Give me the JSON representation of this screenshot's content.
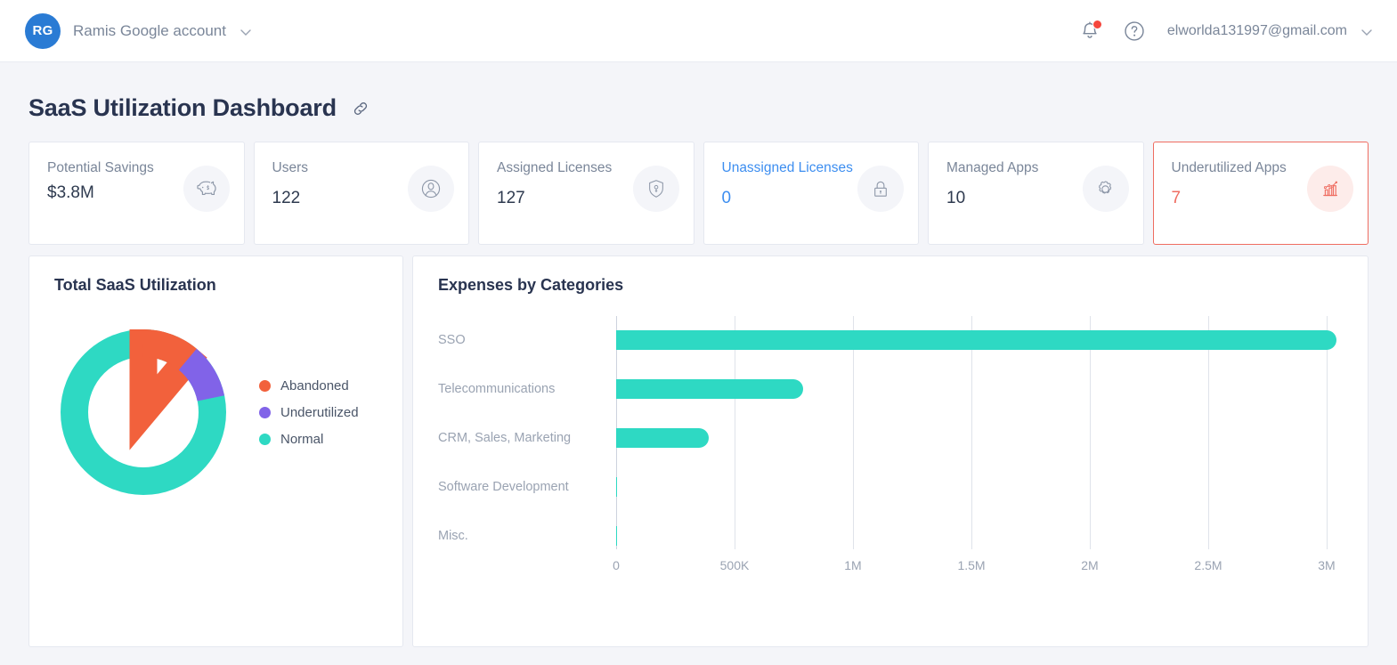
{
  "topbar": {
    "avatar_initials": "RG",
    "account_name": "Ramis Google account",
    "account_chevron": "chevron-down-icon",
    "notifications_icon": "bell-icon",
    "help_icon": "question-circle-icon",
    "email": "elworlda131997@gmail.com",
    "email_chevron": "chevron-down-icon"
  },
  "page": {
    "title": "SaaS Utilization Dashboard",
    "link_icon": "link-icon"
  },
  "kpis": [
    {
      "label": "Potential Savings",
      "value": "$3.8M",
      "icon": "piggy-bank-icon",
      "style": "default",
      "two_line": true
    },
    {
      "label": "Users",
      "value": "122",
      "icon": "user-icon",
      "style": "default",
      "two_line": false
    },
    {
      "label": "Assigned Licenses",
      "value": "127",
      "icon": "shield-key-icon",
      "style": "default",
      "two_line": false
    },
    {
      "label": "Unassigned Licenses",
      "value": "0",
      "icon": "lock-icon",
      "style": "blue",
      "two_line": false
    },
    {
      "label": "Managed Apps",
      "value": "10",
      "icon": "gear-icon",
      "style": "default",
      "two_line": false
    },
    {
      "label": "Underutilized Apps",
      "value": "7",
      "icon": "chart-trend-icon",
      "style": "alert",
      "two_line": false
    }
  ],
  "panels": {
    "left_title": "Total SaaS Utilization",
    "right_title": "Expenses by Categories"
  },
  "colors": {
    "teal": "#2ed9c3",
    "orange": "#f2613c",
    "purple": "#8163e8",
    "alert_red": "#ef6d61",
    "link_blue": "#3d8ef0",
    "avatar_blue": "#2a7bd4",
    "page_bg": "#f4f5f9",
    "title_navy": "#293450"
  },
  "chart_data": [
    {
      "type": "pie",
      "title": "Total SaaS Utilization",
      "variant": "donut",
      "legend_position": "right",
      "labels": [
        "Abandoned",
        "Underutilized",
        "Normal"
      ],
      "values": [
        11.1,
        10.6,
        78.3
      ],
      "colors": [
        "#f2613c",
        "#8163e8",
        "#2ed9c3"
      ],
      "start_angle_deg": 0,
      "inner_radius_ratio": 0.66
    },
    {
      "type": "bar",
      "orientation": "horizontal",
      "title": "Expenses by Categories",
      "categories": [
        "SSO",
        "Telecommunications",
        "CRM, Sales, Marketing",
        "Software Development",
        "Misc."
      ],
      "values": [
        3040000,
        790000,
        390000,
        5000,
        0
      ],
      "series": [
        {
          "name": "Expenses",
          "values": [
            3040000,
            790000,
            390000,
            5000,
            0
          ]
        }
      ],
      "xlabel": "",
      "ylabel": "",
      "xlim": [
        0,
        3200000
      ],
      "tick_values": [
        0,
        500000,
        1000000,
        1500000,
        2000000,
        2500000,
        3000000
      ],
      "tick_labels": [
        "0",
        "500K",
        "1M",
        "1.5M",
        "2M",
        "2.5M",
        "3M"
      ],
      "grid": true,
      "bar_color": "#2ed9c3",
      "legend_position": "none"
    }
  ]
}
